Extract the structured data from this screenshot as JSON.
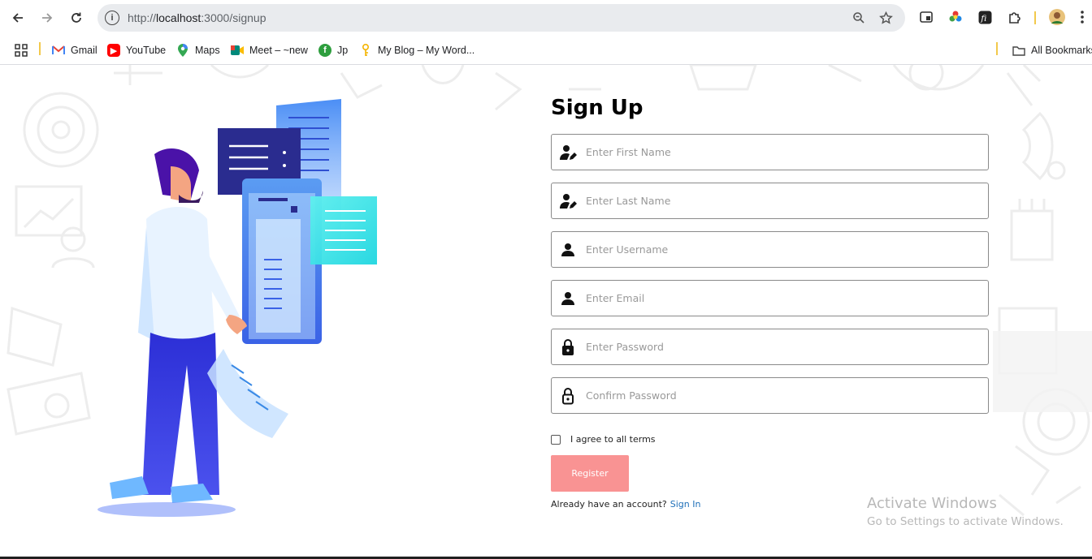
{
  "browser": {
    "url_prefix": "http://",
    "url_host": "localhost",
    "url_rest": ":3000/signup",
    "bookmarks": [
      {
        "label": "Gmail",
        "icon": "gmail-icon",
        "color": "#ea4335"
      },
      {
        "label": "YouTube",
        "icon": "youtube-icon",
        "color": "#ff0000"
      },
      {
        "label": "Maps",
        "icon": "maps-icon",
        "color": "#34a853"
      },
      {
        "label": "Meet – ~new",
        "icon": "meet-icon",
        "color": "#00897b"
      },
      {
        "label": "Jp",
        "icon": "jp-icon",
        "color": "#2e9e3e"
      },
      {
        "label": "My Blog – My Word...",
        "icon": "blog-icon",
        "color": "#f4b400"
      }
    ],
    "all_bookmarks": "All Bookmarks"
  },
  "form": {
    "title": "Sign Up",
    "fields": [
      {
        "placeholder": "Enter First Name",
        "icon": "user-edit-icon"
      },
      {
        "placeholder": "Enter Last Name",
        "icon": "user-edit-icon"
      },
      {
        "placeholder": "Enter Username",
        "icon": "user-icon"
      },
      {
        "placeholder": "Enter Email",
        "icon": "user-icon"
      },
      {
        "placeholder": "Enter Password",
        "icon": "lock-icon"
      },
      {
        "placeholder": "Confirm Password",
        "icon": "lock-outline-icon"
      }
    ],
    "terms_label": "I agree to all terms",
    "register_label": "Register",
    "register_color": "#f99393",
    "account_text": "Already have an account?",
    "signin_label": "Sign In",
    "link_color": "#1e6fb8"
  },
  "watermark": {
    "line1": "Activate Windows",
    "line2": "Go to Settings to activate Windows."
  }
}
